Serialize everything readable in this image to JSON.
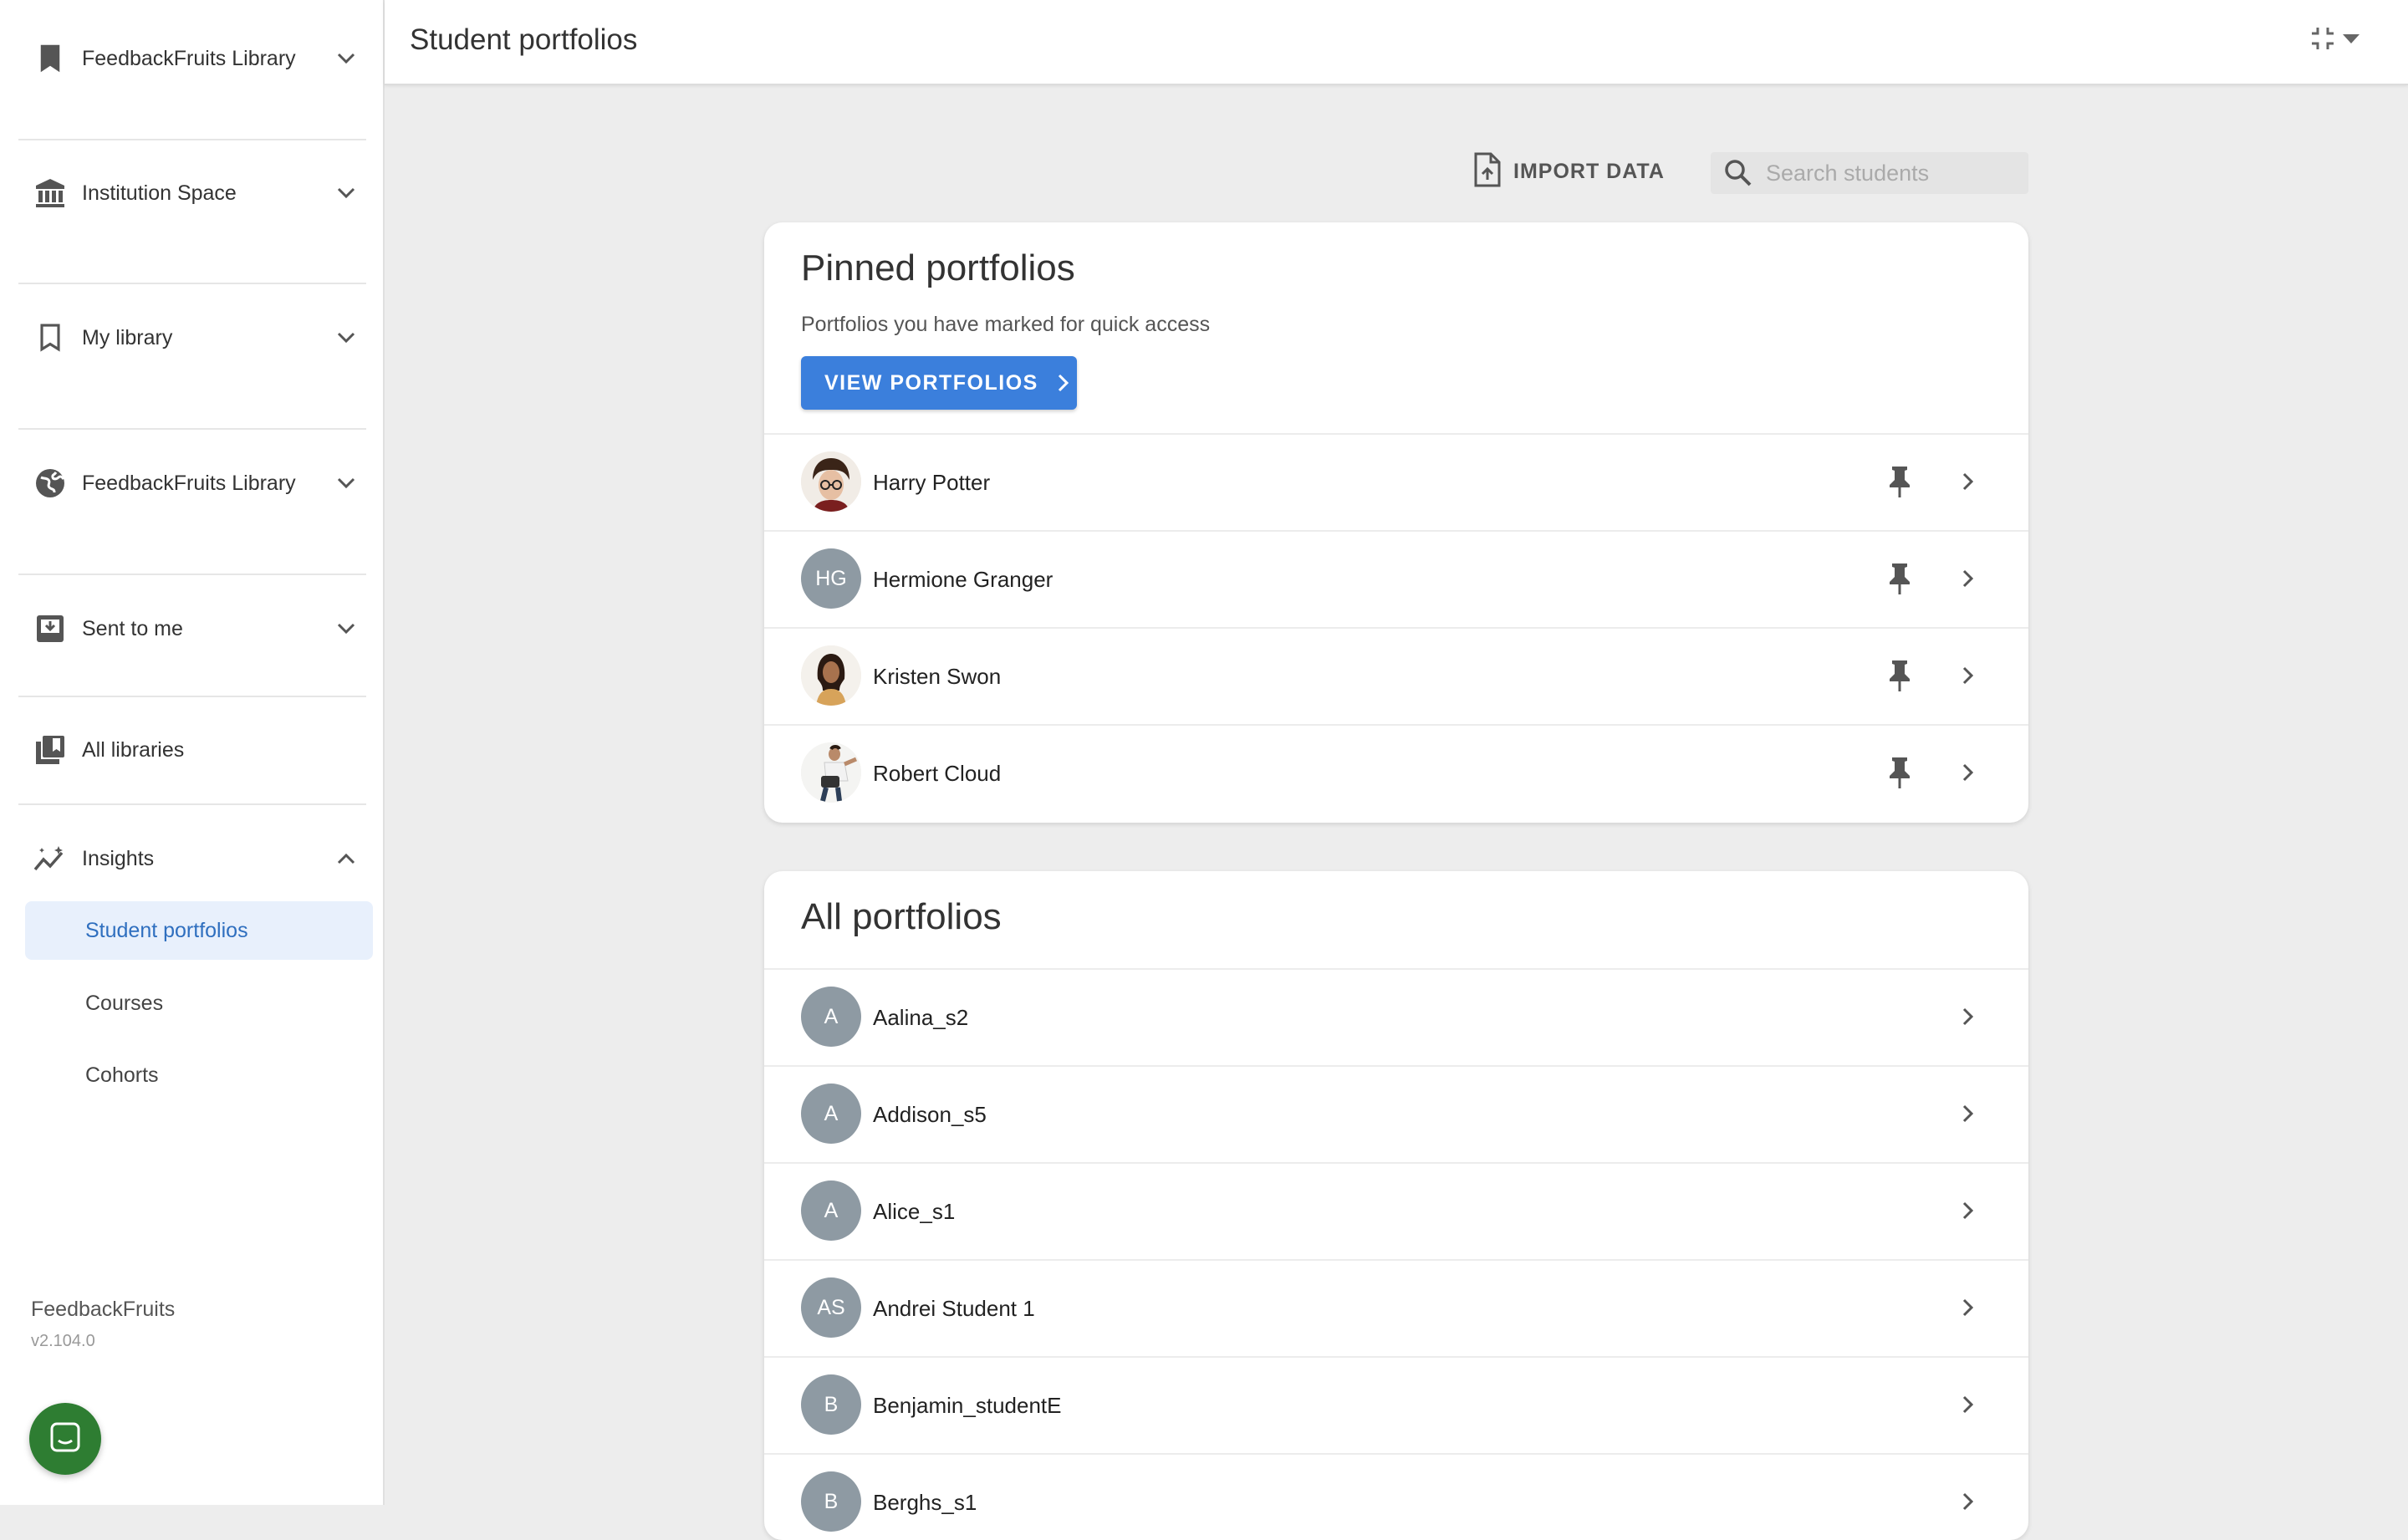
{
  "sidebar": {
    "sections": [
      {
        "label": "FeedbackFruits Library",
        "icon": "bookmark-filled-icon"
      },
      {
        "label": "Institution Space",
        "icon": "institution-icon"
      },
      {
        "label": "My library",
        "icon": "bookmark-outline-icon"
      },
      {
        "label": "FeedbackFruits Library",
        "icon": "globe-icon"
      },
      {
        "label": "Sent to me",
        "icon": "inbox-icon"
      },
      {
        "label": "All libraries",
        "icon": "libraries-icon"
      },
      {
        "label": "Insights",
        "icon": "insights-icon"
      }
    ],
    "insights_items": [
      {
        "label": "Student portfolios",
        "active": true
      },
      {
        "label": "Courses",
        "active": false
      },
      {
        "label": "Cohorts",
        "active": false
      }
    ],
    "brand": "FeedbackFruits",
    "version": "v2.104.0"
  },
  "header": {
    "title": "Student portfolios"
  },
  "toolbar": {
    "import_label": "IMPORT DATA",
    "search_placeholder": "Search students",
    "search_value": ""
  },
  "pinned": {
    "title": "Pinned portfolios",
    "subtitle": "Portfolios you have marked for quick access",
    "button_label": "VIEW PORTFOLIOS",
    "students": [
      {
        "name": "Harry Potter",
        "initials": "",
        "photo": true
      },
      {
        "name": "Hermione Granger",
        "initials": "HG",
        "photo": false
      },
      {
        "name": "Kristen Swon",
        "initials": "",
        "photo": true
      },
      {
        "name": "Robert Cloud",
        "initials": "",
        "photo": true
      }
    ]
  },
  "all": {
    "title": "All portfolios",
    "students": [
      {
        "name": "Aalina_s2",
        "initials": "A"
      },
      {
        "name": "Addison_s5",
        "initials": "A"
      },
      {
        "name": "Alice_s1",
        "initials": "A"
      },
      {
        "name": "Andrei Student 1",
        "initials": "AS"
      },
      {
        "name": "Benjamin_studentE",
        "initials": "B"
      },
      {
        "name": "Berghs_s1",
        "initials": "B"
      }
    ]
  },
  "colors": {
    "accent": "#3b7fdc",
    "active_bg": "#e8f0fc",
    "avatar_bg": "#8e9aa3",
    "chat": "#2e7d32"
  }
}
